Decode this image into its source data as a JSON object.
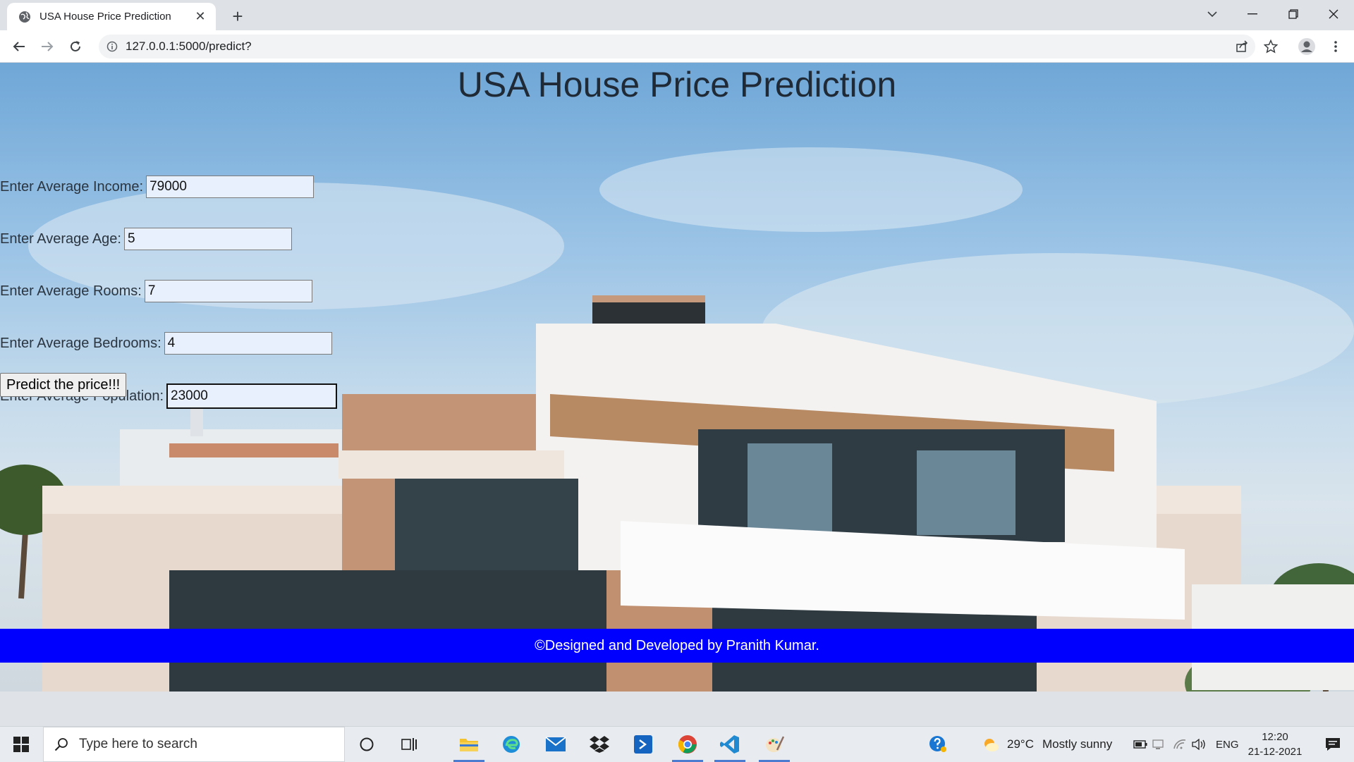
{
  "browser": {
    "tab_title": "USA House Price Prediction",
    "url": "127.0.0.1:5000/predict?"
  },
  "page": {
    "title": "USA House Price Prediction",
    "fields": [
      {
        "label": "Enter Average Income:",
        "value": "79000"
      },
      {
        "label": "Enter Average Age:",
        "value": "5"
      },
      {
        "label": "Enter Average Rooms:",
        "value": "7"
      },
      {
        "label": "Enter Average Bedrooms:",
        "value": "4"
      },
      {
        "label": "Enter Average Population:",
        "value": "23000"
      }
    ],
    "submit_label": "Predict the price!!!",
    "footer": "©Designed and Developed by Pranith Kumar."
  },
  "taskbar": {
    "search_placeholder": "Type here to search",
    "weather_temp": "29°C",
    "weather_text": "Mostly sunny",
    "language": "ENG",
    "time": "12:20",
    "date": "21-12-2021"
  },
  "colors": {
    "footer_bg": "#0000ff",
    "input_bg": "#e8f0fe",
    "title_color": "#1f2a36"
  }
}
